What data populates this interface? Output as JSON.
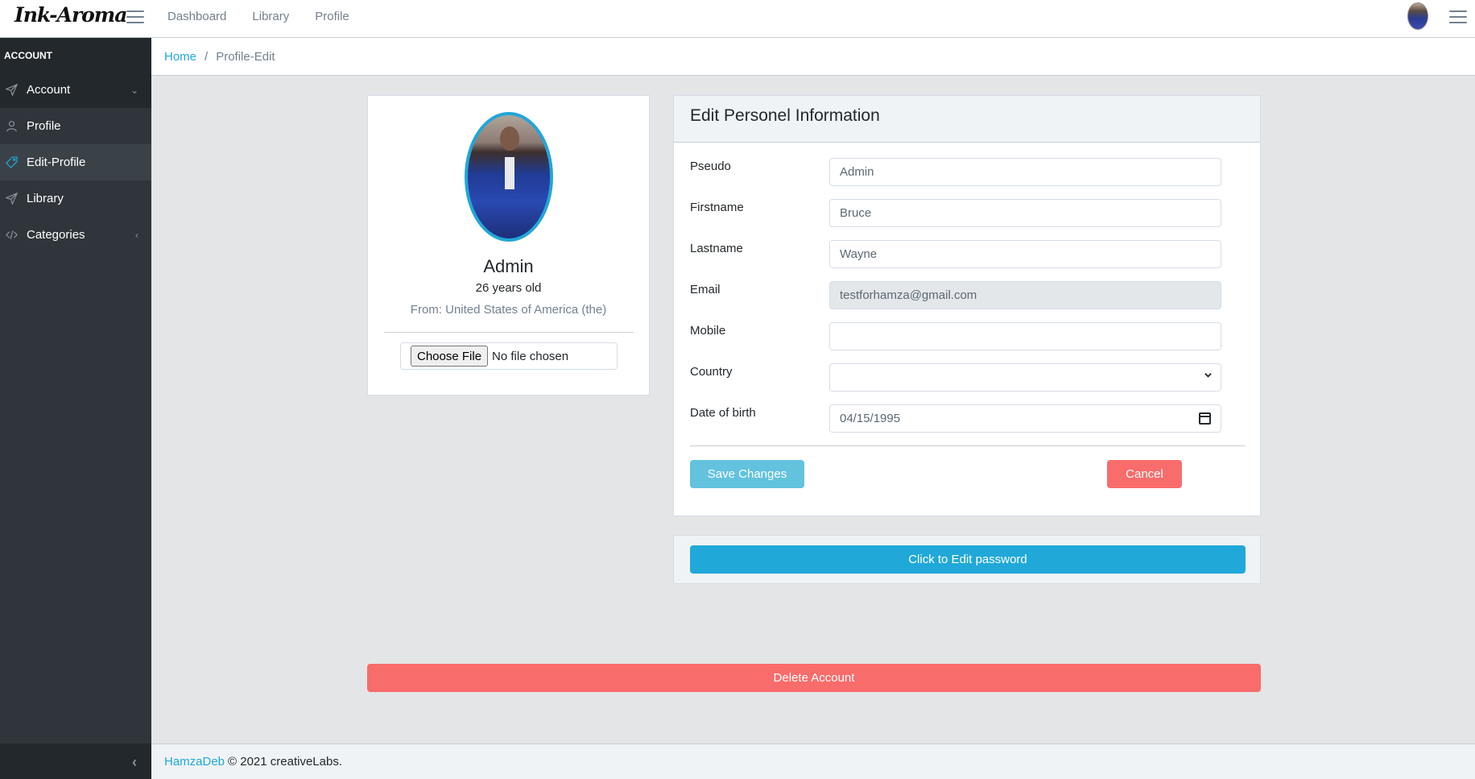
{
  "header": {
    "logo": "Ink-Aroma",
    "nav": [
      {
        "label": "Dashboard"
      },
      {
        "label": "Library"
      },
      {
        "label": "Profile"
      }
    ]
  },
  "sidebar": {
    "title": "ACCOUNT",
    "items": [
      {
        "label": "Account",
        "icon": "send-icon",
        "caret": "⌄"
      },
      {
        "label": "Profile",
        "icon": "user-icon"
      },
      {
        "label": "Edit-Profile",
        "icon": "tag-icon",
        "active": true
      },
      {
        "label": "Library",
        "icon": "send-icon"
      },
      {
        "label": "Categories",
        "icon": "code-icon",
        "caret": "‹"
      }
    ],
    "minimizer": "‹"
  },
  "breadcrumb": {
    "home": "Home",
    "separator": "/",
    "current": "Profile-Edit"
  },
  "profile_card": {
    "name": "Admin",
    "age": "26 years old",
    "from": "From: United States of America (the)",
    "file_button": "Choose File",
    "file_status": "No file chosen"
  },
  "edit_form": {
    "title": "Edit Personel Information",
    "fields": [
      {
        "label": "Pseudo",
        "value": "Admin"
      },
      {
        "label": "Firstname",
        "value": "Bruce"
      },
      {
        "label": "Lastname",
        "value": "Wayne"
      },
      {
        "label": "Email",
        "value": "testforhamza@gmail.com",
        "disabled": true
      },
      {
        "label": "Mobile",
        "value": ""
      },
      {
        "label": "Country",
        "value": ""
      },
      {
        "label": "Date of birth",
        "value": "04/15/1995"
      }
    ],
    "save_label": "Save Changes",
    "cancel_label": "Cancel"
  },
  "password": {
    "button_label": "Click to Edit password"
  },
  "delete": {
    "button_label": "Delete Account"
  },
  "footer": {
    "author": "HamzaDeb",
    "text": "© 2021 creativeLabs."
  },
  "colors": {
    "primary": "#20a8d8",
    "danger": "#f86c6b",
    "info": "#63c2de",
    "sidebar": "#2f353a"
  }
}
